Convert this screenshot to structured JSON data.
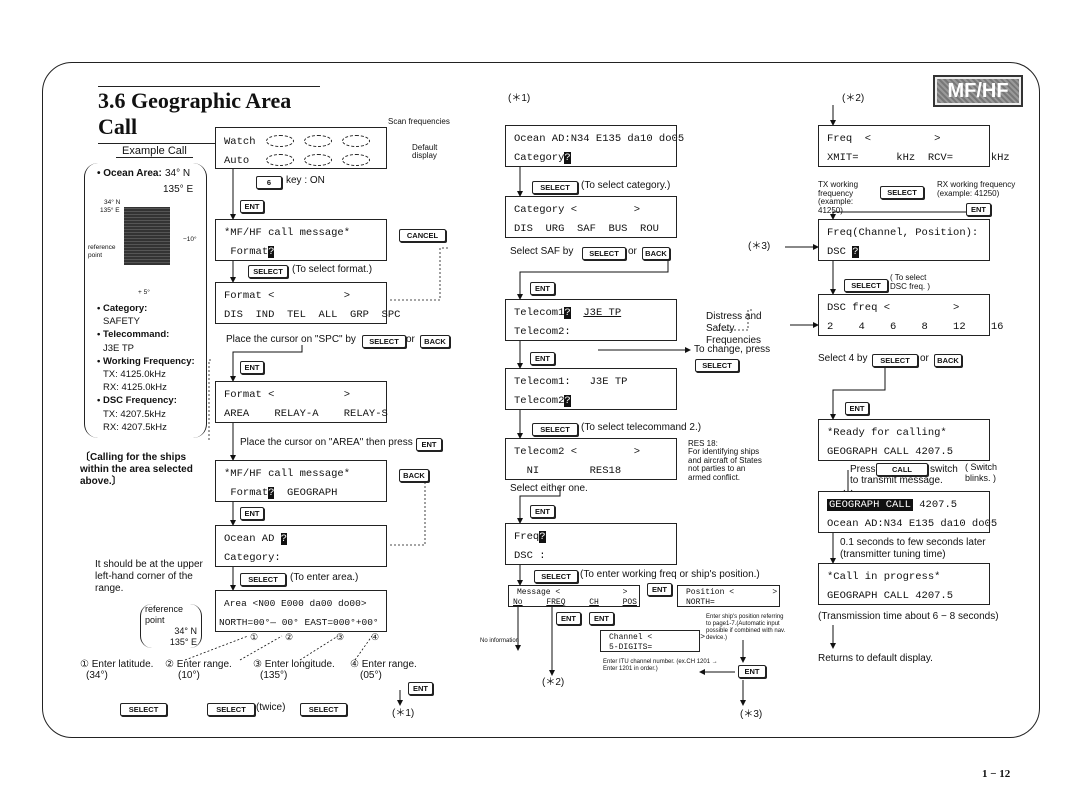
{
  "page": {
    "title": "3.6 Geographic Area Call",
    "badge": "MF/HF",
    "page_number": "1 − 12"
  },
  "keys": {
    "select": "SELECT",
    "ent": "ENT",
    "back": "BACK",
    "cancel": "CANCEL",
    "call": "CALL",
    "six": "6"
  },
  "example": {
    "heading": "Example Call",
    "ocean_label": "• Ocean Area:",
    "ocean_n": "34° N",
    "ocean_e": "135° E",
    "map_corner_n": "34° N",
    "map_corner_e": "135° E",
    "map_ref": "reference point",
    "map_height": "−10°",
    "map_width": "+ 5°",
    "lines": [
      "• Category:",
      "SAFETY",
      "• Telecommand:",
      "J3E TP",
      "• Working Frequency:",
      "TX: 4125.0kHz",
      "RX: 4125.0kHz",
      "• DSC Frequency:",
      "TX: 4207.5kHz",
      "RX: 4207.5kHz"
    ],
    "calling_note": "〔Calling for the ships within the area selected above.〕",
    "upper_left_note": "It should be at the upper left-hand corner of the range.",
    "ref_point": "reference point",
    "ref_n": "34° N",
    "ref_e": "135° E"
  },
  "col1": {
    "scan_freq": "Scan frequencies",
    "default_display": "Default display",
    "watch": "Watch",
    "auto": "Auto",
    "key_on": "key : ON",
    "msg_title": "*MF/HF call message*",
    "format_q": "Format",
    "format_geo": "GEOGRAPH",
    "to_select_format": "(To select format.)",
    "format_header": "Format <           >",
    "format_options": "DIS  IND  TEL  ALL  GRP  SPC",
    "place_spc": "Place the cursor on \"SPC\" by",
    "or": "or",
    "format_options2": "AREA    RELAY-A    RELAY-S",
    "place_area": "Place the cursor on \"AREA\" then press",
    "ocean_ad": "Ocean AD ",
    "category": "Category:",
    "to_enter_area": "(To enter area.)",
    "area_line": "Area <N00 E000 da00 do00>",
    "north_line": "NORTH=00°— 00° EAST=000°+00°",
    "circled": [
      "①",
      "②",
      "③",
      "④"
    ],
    "steps": [
      {
        "label": "① Enter latitude.",
        "value": "(34°)"
      },
      {
        "label": "② Enter range.",
        "value": "(10°)"
      },
      {
        "label": "③ Enter longitude.",
        "value": "(135°)"
      },
      {
        "label": "④ Enter range.",
        "value": "(05°)"
      }
    ],
    "twice": "(twice)",
    "ref1": "(＊1)"
  },
  "col2": {
    "ref1": "(＊1)",
    "ocean_full": "Ocean AD:N34 E135 da10 do05",
    "category_q": "Category",
    "to_select_category": "(To select category.)",
    "category_header": "Category <         >",
    "category_options": "DIS  URG  SAF  BUS  ROU",
    "select_saf": "Select SAF by",
    "telecom1_q": "Telecom1",
    "telecom1_val": "J3E TP",
    "telecom2_colon": "Telecom2:",
    "telecom1_colon": "Telecom1:   J3E TP",
    "telecom2_q": "Telecom2",
    "to_change": "To change, press",
    "distress": "Distress and Safety Frequencies",
    "to_select_tc2": "(To select telecommand 2.)",
    "telecom2_header": "Telecom2 <         >",
    "telecom2_options": "  NI        RES18",
    "res18_title": "RES 18:",
    "res18_text": "For identifying ships and aircraft of States not parties to an armed conflict.",
    "select_either": "Select either one.",
    "freq_q": "Freq",
    "dsc_colon": "DSC :",
    "to_enter_working": "(To enter working freq or ship's position.)",
    "message_header": "Message <             >",
    "message_opts": [
      "No",
      "FREQ",
      "CH",
      "POS"
    ],
    "position_header": "Position <        >",
    "position_north": "NORTH=",
    "channel_header": "Channel <          >",
    "channel_digits": "5-DIGITS=",
    "no_info": "No information",
    "ship_pos_note": "Enter ship's position referring to page1-7.(Automatic input possible if combined with nav. device.)",
    "itu_note": "Enter ITU channel number. (ex.CH 1201 → Enter 1201 in order.)",
    "ref2": "(＊2)",
    "ref3": "(＊3)",
    "ref3_arrow": "(＊3)"
  },
  "col3": {
    "ref2": "(＊2)",
    "freq_header": "Freq  <          >",
    "xmit_line": "XMIT=      kHz  RCV=      kHz",
    "tx_note": "TX working frequency (example: 41250)",
    "rx_note": "RX working frequency (example: 41250)",
    "freq_channel": "Freq(Channel, Position):",
    "dsc": "DSC ",
    "to_select_dsc": "( To select DSC freq. )",
    "dsc_header": "DSC freq <          >",
    "dsc_options": "2    4    6    8    12    16",
    "select_4": "Select 4 by",
    "or": "or",
    "ready": "*Ready for calling*",
    "geo_call": "GEOGRAPH CALL 4207.5",
    "press": "Press",
    "switch": "switch",
    "to_transmit": "to transmit message.",
    "blinks": "( Switch blinks. )",
    "geo_call_inv": "GEOGRAPH CALL",
    "freq_val": "4207.5",
    "ocean_full": "Ocean AD:N34 E135 da10 do05",
    "tuning": "0.1 seconds to few seconds later (transmitter tuning time)",
    "in_progress": "*Call in progress*",
    "geo_call2": "GEOGRAPH CALL 4207.5",
    "tx_time": "(Transmission time about 6 − 8 seconds)",
    "returns": "Returns to default display."
  },
  "cursor": "?"
}
